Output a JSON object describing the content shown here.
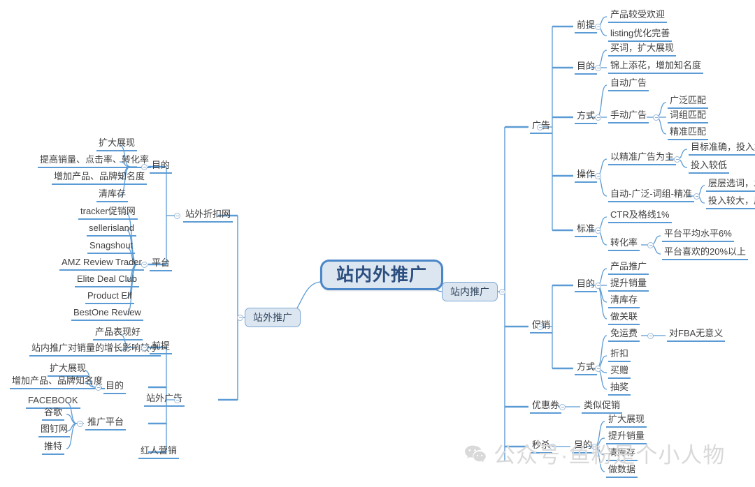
{
  "title": "站内外推广",
  "colors": {
    "link": "#5b9bd5",
    "node_fill": "#dce6f1",
    "node_border": "#7ba7d7",
    "root_border": "#4a86c8",
    "root_text": "#2c4f80",
    "text": "#3f3f3f",
    "background": "#ffffff",
    "watermark": "#d9d9d9"
  },
  "watermark": {
    "icon": "wechat-icon",
    "text": "公众号·鱼粉是个小人物"
  },
  "root": {
    "label": "站内外推广"
  },
  "branches": {
    "inside": {
      "label": "站内推广"
    },
    "outside": {
      "label": "站外推广"
    }
  },
  "nodes": {
    "ad": "广告",
    "ad_premise": "前提",
    "ad_premise_1": "产品较受欢迎",
    "ad_premise_2": "listing优化完善",
    "ad_purpose": "目的",
    "ad_purpose_1": "买词，扩大展现",
    "ad_purpose_2": "锦上添花，增加知名度",
    "ad_method": "方式",
    "ad_method_1": "自动广告",
    "ad_method_2": "手动广告",
    "ad_method_2_1": "广泛匹配",
    "ad_method_2_2": "词组匹配",
    "ad_method_2_3": "精准匹配",
    "ad_op": "操作",
    "ad_op_1": "以精准广告为主",
    "ad_op_1_1": "目标准确，投入集中",
    "ad_op_1_2": "投入较低",
    "ad_op_2": "自动-广泛-词组-精准",
    "ad_op_2_1": "层层选词，发现好词",
    "ad_op_2_2": "投入较大，周期长",
    "ad_std": "标准",
    "ad_std_1": "CTR及格线1%",
    "ad_std_2": "转化率",
    "ad_std_2_1": "平台平均水平6%",
    "ad_std_2_2": "平台喜欢的20%以上",
    "promo": "促销",
    "promo_purpose": "目的",
    "promo_purpose_1": "产品推广",
    "promo_purpose_2": "提升销量",
    "promo_purpose_3": "清库存",
    "promo_purpose_4": "做关联",
    "promo_method": "方式",
    "promo_method_1": "免运费",
    "promo_method_1_1": "对FBA无意义",
    "promo_method_2": "折扣",
    "promo_method_3": "买赠",
    "promo_method_4": "抽奖",
    "coupon": "优惠券",
    "coupon_1": "类似促销",
    "flash": "秒杀",
    "flash_purpose": "目的",
    "flash_purpose_1": "扩大展现",
    "flash_purpose_2": "提升销量",
    "flash_purpose_3": "清库存",
    "flash_purpose_4": "做数据",
    "offsite_deal": "站外折扣网",
    "od_purpose": "目的",
    "od_purpose_1": "扩大展现",
    "od_purpose_2": "提高销量、点击率、转化率",
    "od_purpose_3": "增加产品、品牌知名度",
    "od_purpose_4": "清库存",
    "od_platform": "平台",
    "od_platform_1": "tracker促销网",
    "od_platform_2": "sellerisland",
    "od_platform_3": "Snagshout",
    "od_platform_4": "AMZ Review Trader",
    "od_platform_5": "Elite Deal Club",
    "od_platform_6": "Product Elf",
    "od_platform_7": "BestOne Review",
    "offsite_ad": "站外广告",
    "oa_premise": "前提",
    "oa_premise_1": "产品表现好",
    "oa_premise_2": "站内推广对销量的增长影响较小",
    "oa_purpose": "目的",
    "oa_purpose_1": "扩大展现",
    "oa_purpose_2": "增加产品、品牌知名度",
    "oa_platform": "推广平台",
    "oa_platform_1": "FACEBOOK",
    "oa_platform_2": "谷歌",
    "oa_platform_3": "图钉网",
    "oa_platform_4": "推特",
    "influencer": "红人营销"
  }
}
